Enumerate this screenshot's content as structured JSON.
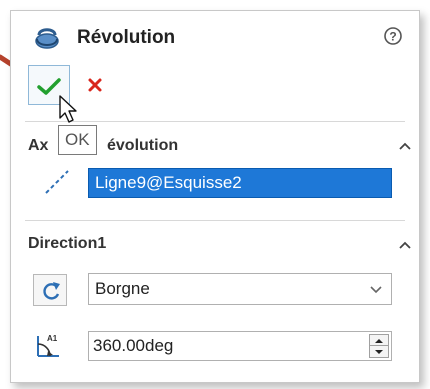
{
  "panel": {
    "title": "Révolution",
    "feature_icon": "revolve-feature-icon",
    "help_icon": "help-icon",
    "ok_tooltip": "OK"
  },
  "axis_section": {
    "title_left": "Ax",
    "title_right": "évolution",
    "icon": "axis-line-icon",
    "selected_value": "Ligne9@Esquisse2"
  },
  "direction_section": {
    "title": "Direction1",
    "reverse_icon": "reverse-direction-icon",
    "end_condition": "Borgne",
    "angle_icon": "angle-icon",
    "angle_value": "360.00deg"
  },
  "colors": {
    "accent_blue": "#1e78d7",
    "ok_green": "#22a02f",
    "cancel_red": "#d9261c",
    "pointer_arrow": "#b5422c"
  }
}
